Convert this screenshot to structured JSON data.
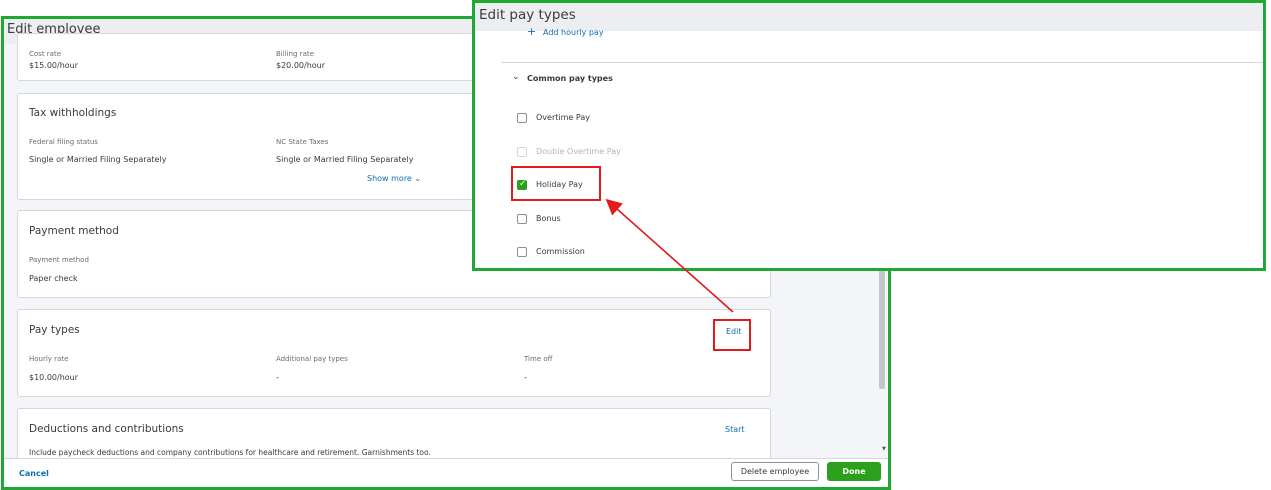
{
  "employee_window": {
    "title": "Edit employee",
    "rates": {
      "cost_rate_label": "Cost rate",
      "cost_rate_value": "$15.00/hour",
      "billing_rate_label": "Billing rate",
      "billing_rate_value": "$20.00/hour"
    },
    "tax": {
      "title": "Tax withholdings",
      "federal_label": "Federal filing status",
      "federal_value": "Single or Married Filing Separately",
      "state_label": "NC State Taxes",
      "state_value": "Single or Married Filing Separately",
      "show_more": "Show more"
    },
    "payment": {
      "title": "Payment method",
      "method_label": "Payment method",
      "method_value": "Paper check"
    },
    "pay_types": {
      "title": "Pay types",
      "edit_label": "Edit",
      "hourly_label": "Hourly rate",
      "hourly_value": "$10.00/hour",
      "additional_label": "Additional pay types",
      "additional_value": "-",
      "timeoff_label": "Time off",
      "timeoff_value": "-"
    },
    "deductions": {
      "title": "Deductions and contributions",
      "start_label": "Start",
      "description": "Include paycheck deductions and company contributions for healthcare and retirement. Garnishments too."
    },
    "footer": {
      "cancel_label": "Cancel",
      "delete_label": "Delete employee",
      "done_label": "Done"
    }
  },
  "paytypes_window": {
    "title": "Edit pay types",
    "add_hourly_label": "Add hourly pay",
    "common_header": "Common pay types",
    "items": [
      {
        "label": "Overtime Pay",
        "checked": false,
        "disabled": false
      },
      {
        "label": "Double Overtime Pay",
        "checked": false,
        "disabled": true
      },
      {
        "label": "Holiday Pay",
        "checked": true,
        "disabled": false
      },
      {
        "label": "Bonus",
        "checked": false,
        "disabled": false
      },
      {
        "label": "Commission",
        "checked": false,
        "disabled": false
      }
    ]
  },
  "colors": {
    "window_border": "#1fa834",
    "highlight": "#e3191b",
    "accent_green": "#2ca01c",
    "link_blue": "#0d6fb3"
  }
}
